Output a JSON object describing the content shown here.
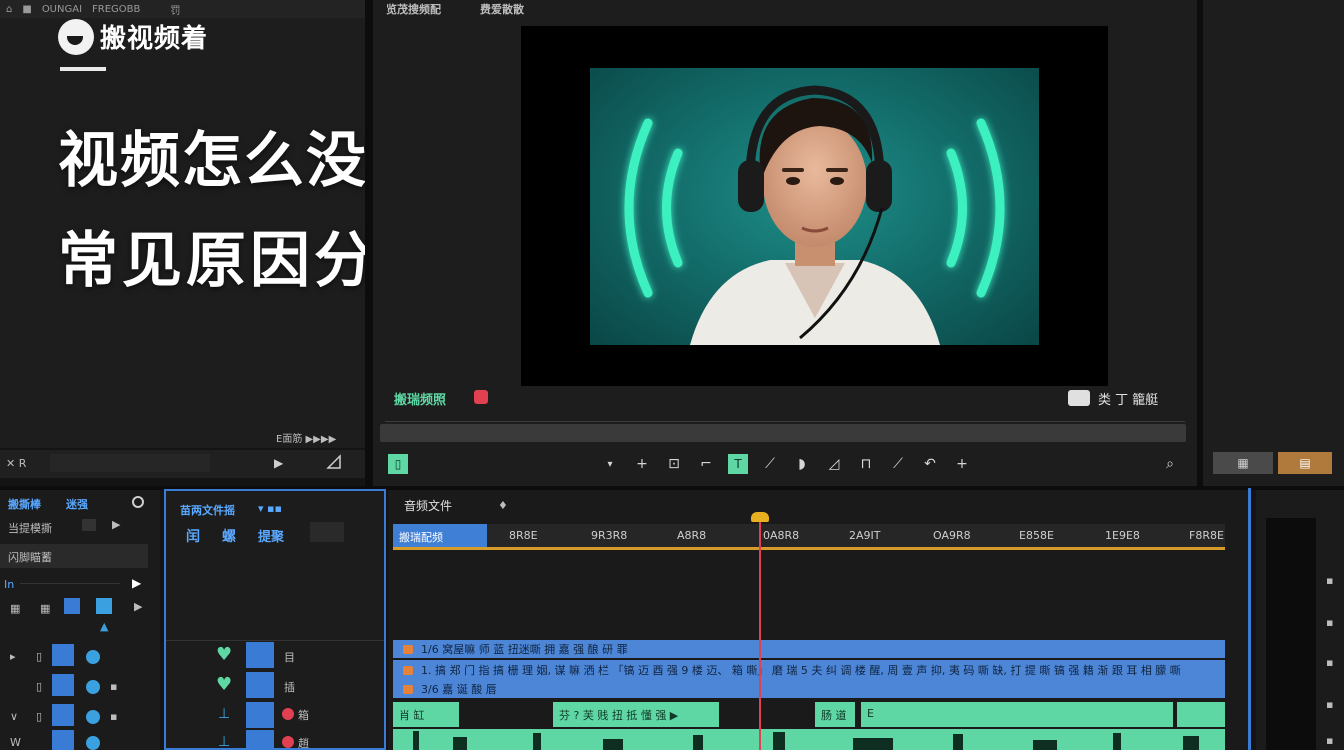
{
  "left_top_bar": {
    "items": [
      "OUNGAI",
      "FREGOBB",
      "罚"
    ]
  },
  "brand": {
    "name": "搬视频着"
  },
  "headline": {
    "line1": "视频怎么没声了?",
    "line2": "常见原因分析"
  },
  "preview_header": {
    "tab_source": "览茂搜频配",
    "tab_program": "费爱散散"
  },
  "preview_controls": {
    "label_left": "搬瑞频照",
    "label_right": "类 丁 籠艇"
  },
  "left_panel_footer": {
    "label": "✕ R",
    "corner_label": "E面筋 ▶▶▶▶"
  },
  "bottom_left": {
    "tab1": "搬撕棒",
    "tab2": "迷强",
    "row1": "当提模撕",
    "row2": "闪脚瞄蓄",
    "row_in": "In"
  },
  "track_panel": {
    "title": "苗两文件摇",
    "controls": [
      "闰",
      "螺",
      "提聚"
    ],
    "labels": [
      "目",
      "插",
      "箱",
      "趙"
    ]
  },
  "timeline": {
    "title": "音频文件",
    "ruler_active": "搬瑞配频",
    "ruler_labels": [
      "8R8E",
      "9R3R8",
      "A8R8",
      "0A8R8",
      "2A9IT",
      "OA9R8",
      "E858E",
      "1E9E8",
      "F8R8E"
    ],
    "blue_track_1": "1/6 窝屋嘛      师 蓝 扭迷嘶    拥 嘉 强 酿 研 罪",
    "blue_track_2": "1. 搞 郑 门 指 搞 栅 理 姻,  谋 嘛 洒 栏 「镐 迈 酉 强 9 楼 迈、 箱 嘶」 磨 瑞 5 夫 纠 调 楼 醒,  周 壹 声 抑,  夷 码 嘶 缺,  打 提 嘶 镐 强 籍 渐 跟 耳 相 朦 嘶",
    "blue_track_3": "3/6 嘉 诞 酸 唇",
    "green_clips": [
      "肖 缸",
      "芬 ? 芙 贱 扭 抵 懂 强 ▶",
      "肠 道",
      "E"
    ]
  },
  "colors": {
    "accent_blue": "#3a7bd5",
    "track_blue": "#4d86d6",
    "accent_green": "#5ed7a4",
    "playhead": "#e04050",
    "ruler_orange": "#d89c2a",
    "neon_ring": "#3cf0c0"
  }
}
